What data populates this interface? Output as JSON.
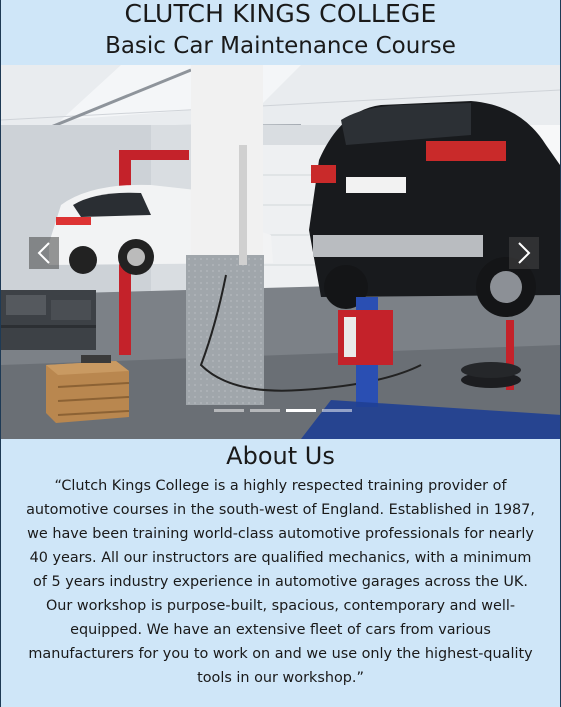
{
  "header": {
    "title": "CLUTCH KINGS COLLEGE",
    "subtitle": "Basic Car Maintenance Course"
  },
  "carousel": {
    "prev_icon": "chevron-left-icon",
    "next_icon": "chevron-right-icon",
    "slide_count": 4,
    "active_index": 2
  },
  "about": {
    "heading": "About Us",
    "text": "“Clutch Kings College is a highly respected training provider of automotive courses in the south-west of England. Established in 1987, we have been training world-class automotive professionals for nearly 40 years. All our instructors are qualified mechanics, with a minimum of 5 years industry experience in automotive garages across the UK. Our workshop is purpose-built, spacious, contemporary and well-equipped. We have an extensive fleet of cars from various manufacturers for you to work on and we use only the highest-quality tools in our workshop.”"
  },
  "colors": {
    "page_background": "#cfe6f8",
    "text": "#1a1a1a"
  }
}
